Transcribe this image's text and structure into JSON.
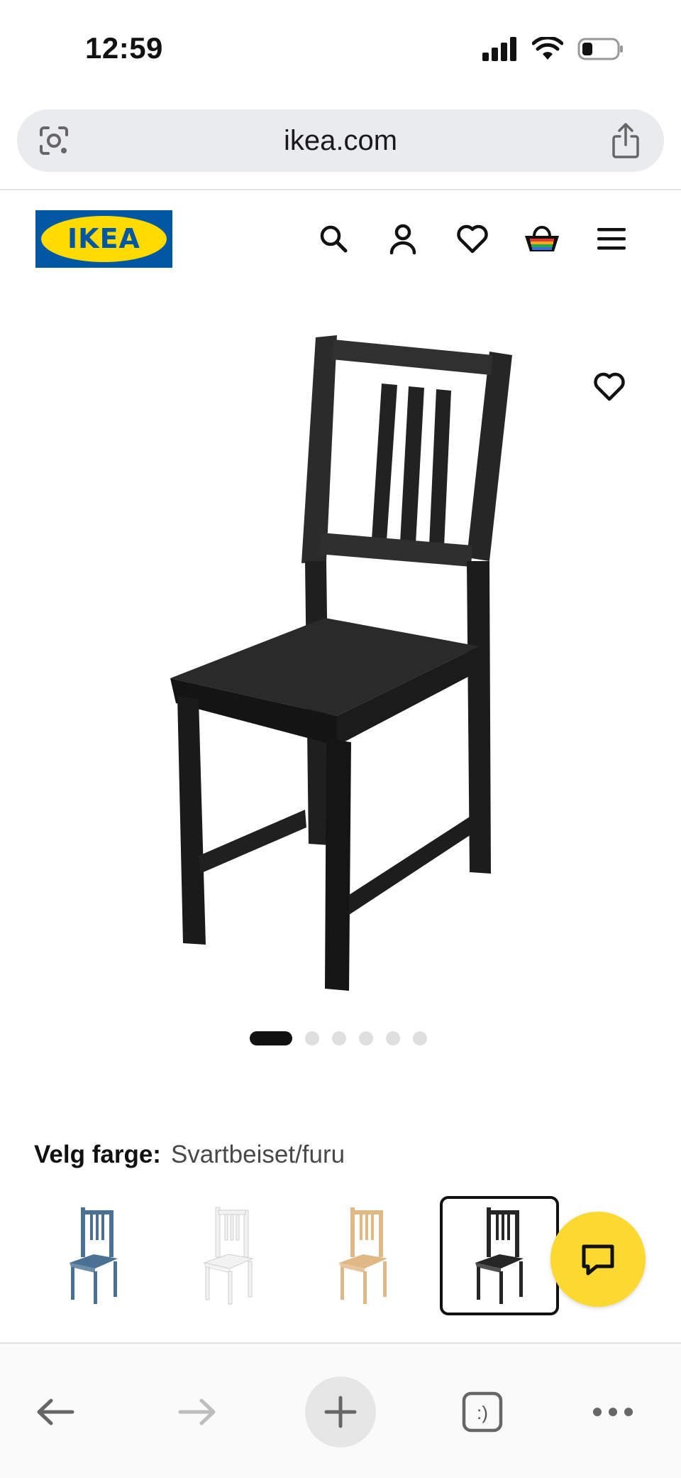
{
  "status_bar": {
    "time": "12:59"
  },
  "browser": {
    "url": "ikea.com"
  },
  "header": {
    "logo_text": "IKEA",
    "brand_blue": "#0058a3",
    "brand_yellow": "#ffdb00"
  },
  "product": {
    "carousel": {
      "total": 6,
      "active_index": 0
    }
  },
  "color_select": {
    "label": "Velg farge:",
    "value": "Svartbeiset/furu",
    "variants": [
      {
        "name": "blue",
        "color": "#4a7194",
        "selected": false
      },
      {
        "name": "white",
        "color": "#f2f2f2",
        "selected": false
      },
      {
        "name": "pine",
        "color": "#e0b885",
        "selected": false
      },
      {
        "name": "black",
        "color": "#262626",
        "selected": true
      }
    ]
  },
  "chat": {
    "color": "#fcd931"
  },
  "toolbar": {
    "icons": [
      "back-arrow-icon",
      "forward-arrow-icon",
      "new-tab-icon",
      "tabs-icon",
      "more-icon"
    ],
    "tabs_glyph": ":)"
  }
}
